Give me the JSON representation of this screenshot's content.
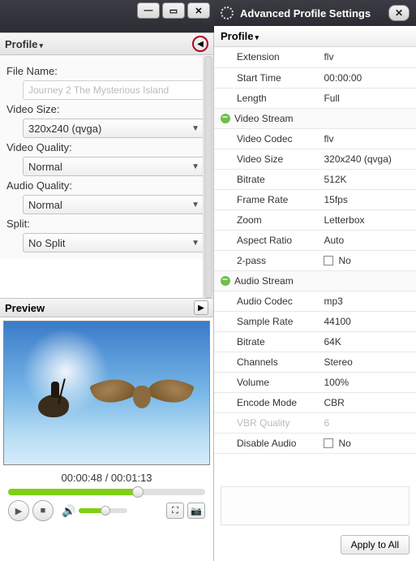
{
  "left": {
    "profile_label": "Profile",
    "filename_label": "File Name:",
    "filename_value": "Journey 2 The Mysterious Island",
    "videosize_label": "Video Size:",
    "videosize_value": "320x240 (qvga)",
    "videoquality_label": "Video Quality:",
    "videoquality_value": "Normal",
    "audioquality_label": "Audio Quality:",
    "audioquality_value": "Normal",
    "split_label": "Split:",
    "split_value": "No Split",
    "preview_label": "Preview",
    "time_current": "00:00:48",
    "time_total": "00:01:13"
  },
  "right": {
    "title": "Advanced Profile Settings",
    "profile_label": "Profile",
    "rows": {
      "extension_k": "Extension",
      "extension_v": "flv",
      "start_k": "Start Time",
      "start_v": "00:00:00",
      "length_k": "Length",
      "length_v": "Full",
      "vstream": "Video Stream",
      "vcodec_k": "Video Codec",
      "vcodec_v": "flv",
      "vsize_k": "Video Size",
      "vsize_v": "320x240 (qvga)",
      "vbitrate_k": "Bitrate",
      "vbitrate_v": "512K",
      "vfps_k": "Frame Rate",
      "vfps_v": "15fps",
      "zoom_k": "Zoom",
      "zoom_v": "Letterbox",
      "aspect_k": "Aspect Ratio",
      "aspect_v": "Auto",
      "twopass_k": "2-pass",
      "twopass_v": "No",
      "astream": "Audio Stream",
      "acodec_k": "Audio Codec",
      "acodec_v": "mp3",
      "srate_k": "Sample Rate",
      "srate_v": "44100",
      "abitrate_k": "Bitrate",
      "abitrate_v": "64K",
      "channels_k": "Channels",
      "channels_v": "Stereo",
      "volume_k": "Volume",
      "volume_v": "100%",
      "encmode_k": "Encode Mode",
      "encmode_v": "CBR",
      "vbrq_k": "VBR Quality",
      "vbrq_v": "6",
      "disaudio_k": "Disable Audio",
      "disaudio_v": "No"
    },
    "apply_label": "Apply to All"
  }
}
